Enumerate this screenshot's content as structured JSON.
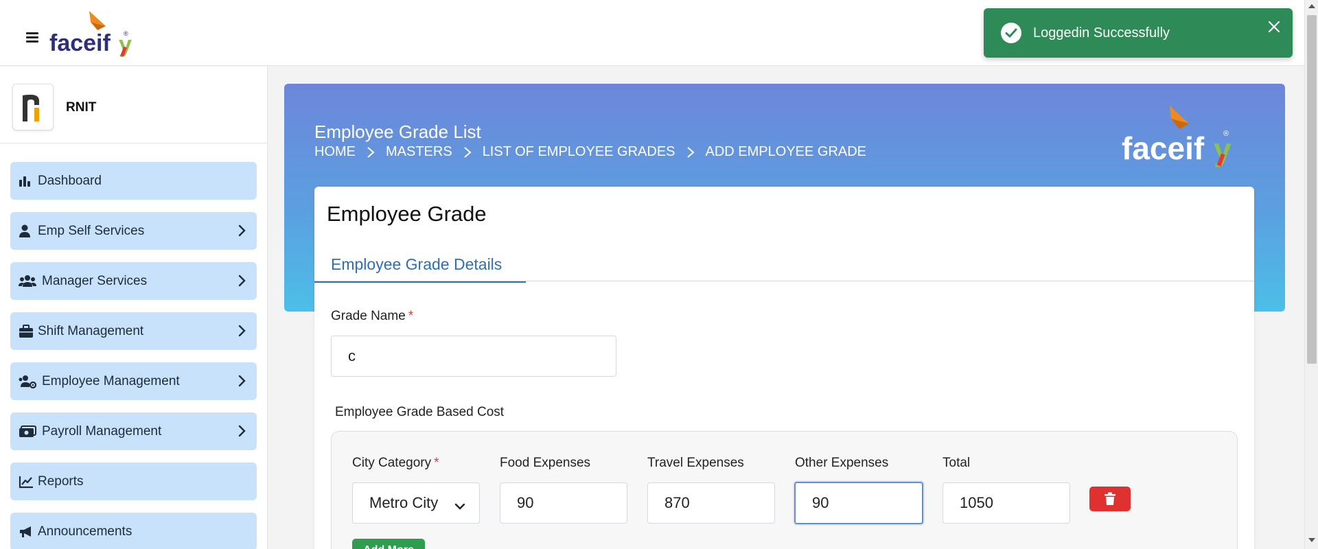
{
  "brand": {
    "name": "faceify",
    "colors": {
      "face": "#2d2f7a",
      "accent": "#f08a1d",
      "green": "#8bc34a",
      "red": "#e53935"
    }
  },
  "company": {
    "name": "RNIT"
  },
  "sidebar": {
    "items": [
      {
        "label": "Dashboard",
        "icon": "bar-chart-icon",
        "has_children": false
      },
      {
        "label": "Emp Self Services",
        "icon": "user-icon",
        "has_children": true
      },
      {
        "label": "Manager Services",
        "icon": "users-icon",
        "has_children": true
      },
      {
        "label": "Shift Management",
        "icon": "briefcase-icon",
        "has_children": true
      },
      {
        "label": "Employee Management",
        "icon": "users-gear-icon",
        "has_children": true
      },
      {
        "label": "Payroll Management",
        "icon": "money-icon",
        "has_children": true
      },
      {
        "label": "Reports",
        "icon": "line-chart-icon",
        "has_children": false
      },
      {
        "label": "Announcements",
        "icon": "megaphone-icon",
        "has_children": false
      }
    ]
  },
  "header": {
    "title": "Employee Grade List",
    "breadcrumb": [
      "HOME",
      "MASTERS",
      "LIST OF EMPLOYEE GRADES",
      "ADD EMPLOYEE GRADE"
    ]
  },
  "form": {
    "card_title": "Employee Grade",
    "tab_label": "Employee Grade Details",
    "grade_name_label": "Grade Name",
    "required_mark": "*",
    "grade_name_value": "c",
    "cost_section_label": "Employee Grade Based Cost",
    "columns": {
      "city_category": "City Category",
      "food": "Food Expenses",
      "travel": "Travel Expenses",
      "other": "Other Expenses",
      "total": "Total"
    },
    "row": {
      "city_category": "Metro City",
      "food": "90",
      "travel": "870",
      "other": "90",
      "total": "1050"
    },
    "add_more_label": "Add More"
  },
  "toast": {
    "message": "Loggedin Successfully",
    "color": "#2e8b57"
  }
}
